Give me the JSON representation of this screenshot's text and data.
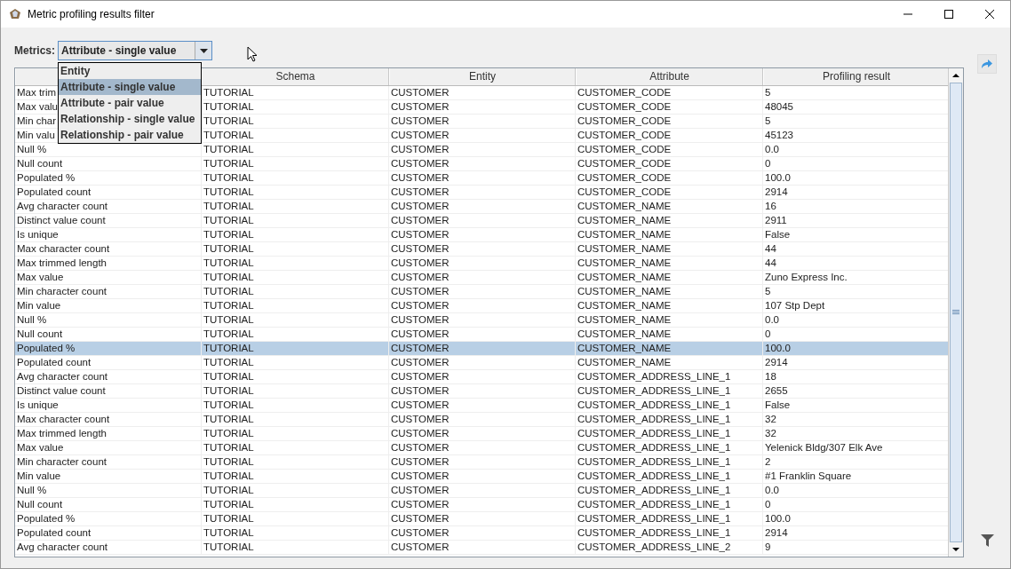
{
  "window": {
    "title": "Metric profiling results filter"
  },
  "metrics": {
    "label": "Metrics:",
    "value": "Attribute - single value",
    "expanded": true,
    "options": [
      {
        "label": "Entity",
        "selected": false
      },
      {
        "label": "Attribute - single value",
        "selected": true
      },
      {
        "label": "Attribute - pair value",
        "selected": false
      },
      {
        "label": "Relationship - single value",
        "selected": false
      },
      {
        "label": "Relationship - pair value",
        "selected": false
      }
    ]
  },
  "table": {
    "columns": [
      "",
      "Schema",
      "Entity",
      "Attribute",
      "Profiling result"
    ],
    "rows": [
      {
        "cells": [
          "Max trim",
          "TUTORIAL",
          "CUSTOMER",
          "CUSTOMER_CODE",
          "5"
        ],
        "selected": false
      },
      {
        "cells": [
          "Max valu",
          "TUTORIAL",
          "CUSTOMER",
          "CUSTOMER_CODE",
          "48045"
        ],
        "selected": false
      },
      {
        "cells": [
          "Min char",
          "TUTORIAL",
          "CUSTOMER",
          "CUSTOMER_CODE",
          "5"
        ],
        "selected": false
      },
      {
        "cells": [
          "Min valu",
          "TUTORIAL",
          "CUSTOMER",
          "CUSTOMER_CODE",
          "45123"
        ],
        "selected": false
      },
      {
        "cells": [
          "Null %",
          "TUTORIAL",
          "CUSTOMER",
          "CUSTOMER_CODE",
          "0.0"
        ],
        "selected": false
      },
      {
        "cells": [
          "Null count",
          "TUTORIAL",
          "CUSTOMER",
          "CUSTOMER_CODE",
          "0"
        ],
        "selected": false
      },
      {
        "cells": [
          "Populated %",
          "TUTORIAL",
          "CUSTOMER",
          "CUSTOMER_CODE",
          "100.0"
        ],
        "selected": false
      },
      {
        "cells": [
          "Populated count",
          "TUTORIAL",
          "CUSTOMER",
          "CUSTOMER_CODE",
          "2914"
        ],
        "selected": false
      },
      {
        "cells": [
          "Avg character count",
          "TUTORIAL",
          "CUSTOMER",
          "CUSTOMER_NAME",
          "16"
        ],
        "selected": false
      },
      {
        "cells": [
          "Distinct value count",
          "TUTORIAL",
          "CUSTOMER",
          "CUSTOMER_NAME",
          "2911"
        ],
        "selected": false
      },
      {
        "cells": [
          "Is unique",
          "TUTORIAL",
          "CUSTOMER",
          "CUSTOMER_NAME",
          "False"
        ],
        "selected": false
      },
      {
        "cells": [
          "Max character count",
          "TUTORIAL",
          "CUSTOMER",
          "CUSTOMER_NAME",
          "44"
        ],
        "selected": false
      },
      {
        "cells": [
          "Max trimmed length",
          "TUTORIAL",
          "CUSTOMER",
          "CUSTOMER_NAME",
          "44"
        ],
        "selected": false
      },
      {
        "cells": [
          "Max value",
          "TUTORIAL",
          "CUSTOMER",
          "CUSTOMER_NAME",
          "Zuno Express Inc."
        ],
        "selected": false
      },
      {
        "cells": [
          "Min character count",
          "TUTORIAL",
          "CUSTOMER",
          "CUSTOMER_NAME",
          "5"
        ],
        "selected": false
      },
      {
        "cells": [
          "Min value",
          "TUTORIAL",
          "CUSTOMER",
          "CUSTOMER_NAME",
          "107 Stp Dept"
        ],
        "selected": false
      },
      {
        "cells": [
          "Null %",
          "TUTORIAL",
          "CUSTOMER",
          "CUSTOMER_NAME",
          "0.0"
        ],
        "selected": false
      },
      {
        "cells": [
          "Null count",
          "TUTORIAL",
          "CUSTOMER",
          "CUSTOMER_NAME",
          "0"
        ],
        "selected": false
      },
      {
        "cells": [
          "Populated %",
          "TUTORIAL",
          "CUSTOMER",
          "CUSTOMER_NAME",
          "100.0"
        ],
        "selected": true
      },
      {
        "cells": [
          "Populated count",
          "TUTORIAL",
          "CUSTOMER",
          "CUSTOMER_NAME",
          "2914"
        ],
        "selected": false
      },
      {
        "cells": [
          "Avg character count",
          "TUTORIAL",
          "CUSTOMER",
          "CUSTOMER_ADDRESS_LINE_1",
          "18"
        ],
        "selected": false
      },
      {
        "cells": [
          "Distinct value count",
          "TUTORIAL",
          "CUSTOMER",
          "CUSTOMER_ADDRESS_LINE_1",
          "2655"
        ],
        "selected": false
      },
      {
        "cells": [
          "Is unique",
          "TUTORIAL",
          "CUSTOMER",
          "CUSTOMER_ADDRESS_LINE_1",
          "False"
        ],
        "selected": false
      },
      {
        "cells": [
          "Max character count",
          "TUTORIAL",
          "CUSTOMER",
          "CUSTOMER_ADDRESS_LINE_1",
          "32"
        ],
        "selected": false
      },
      {
        "cells": [
          "Max trimmed length",
          "TUTORIAL",
          "CUSTOMER",
          "CUSTOMER_ADDRESS_LINE_1",
          "32"
        ],
        "selected": false
      },
      {
        "cells": [
          "Max value",
          "TUTORIAL",
          "CUSTOMER",
          "CUSTOMER_ADDRESS_LINE_1",
          "Yelenick Bldg/307 Elk Ave"
        ],
        "selected": false
      },
      {
        "cells": [
          "Min character count",
          "TUTORIAL",
          "CUSTOMER",
          "CUSTOMER_ADDRESS_LINE_1",
          "2"
        ],
        "selected": false
      },
      {
        "cells": [
          "Min value",
          "TUTORIAL",
          "CUSTOMER",
          "CUSTOMER_ADDRESS_LINE_1",
          "#1 Franklin Square"
        ],
        "selected": false
      },
      {
        "cells": [
          "Null %",
          "TUTORIAL",
          "CUSTOMER",
          "CUSTOMER_ADDRESS_LINE_1",
          "0.0"
        ],
        "selected": false
      },
      {
        "cells": [
          "Null count",
          "TUTORIAL",
          "CUSTOMER",
          "CUSTOMER_ADDRESS_LINE_1",
          "0"
        ],
        "selected": false
      },
      {
        "cells": [
          "Populated %",
          "TUTORIAL",
          "CUSTOMER",
          "CUSTOMER_ADDRESS_LINE_1",
          "100.0"
        ],
        "selected": false
      },
      {
        "cells": [
          "Populated count",
          "TUTORIAL",
          "CUSTOMER",
          "CUSTOMER_ADDRESS_LINE_1",
          "2914"
        ],
        "selected": false
      },
      {
        "cells": [
          "Avg character count",
          "TUTORIAL",
          "CUSTOMER",
          "CUSTOMER_ADDRESS_LINE_2",
          "9"
        ],
        "selected": false
      }
    ]
  }
}
